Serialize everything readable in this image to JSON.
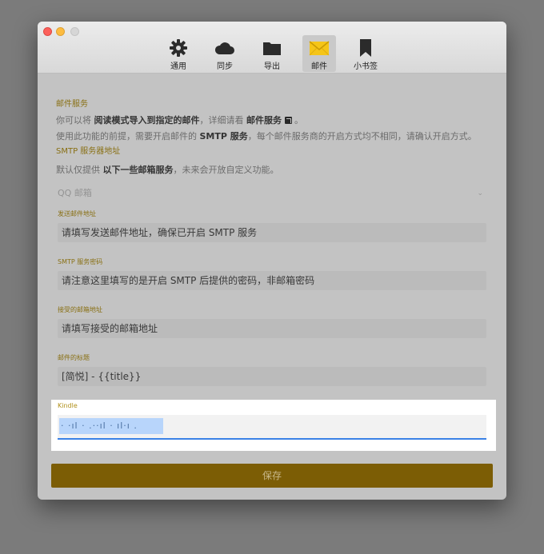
{
  "toolbar": {
    "tabs": [
      {
        "label": "通用",
        "icon": "gear-icon"
      },
      {
        "label": "同步",
        "icon": "cloud-icon"
      },
      {
        "label": "导出",
        "icon": "folder-icon"
      },
      {
        "label": "邮件",
        "icon": "mail-icon",
        "active": true
      },
      {
        "label": "小书签",
        "icon": "bookmark-icon"
      }
    ]
  },
  "mail_service": {
    "heading": "邮件服务",
    "line1_prefix": "你可以将",
    "line1_bold": "阅读模式导入到指定的邮件",
    "line1_mid": "，详细请看",
    "line1_link": "邮件服务",
    "line1_suffix": "。",
    "line2_prefix": "使用此功能的前提，需要开启邮件的",
    "line2_bold": "SMTP 服务",
    "line2_suffix": "，每个邮件服务商的开启方式均不相同，请确认开启方式。"
  },
  "smtp_server": {
    "heading": "SMTP 服务器地址",
    "desc_prefix": "默认仅提供",
    "desc_bold": "以下一些邮箱服务",
    "desc_suffix": "，未来会开放自定义功能。",
    "selected": "QQ 邮箱"
  },
  "fields": {
    "sender_label": "发送邮件地址",
    "sender_placeholder": "请填写发送邮件地址，确保已开启 SMTP 服务",
    "password_label": "SMTP 服务密码",
    "password_placeholder": "请注意这里填写的是开启 SMTP 后提供的密码，非邮箱密码",
    "receiver_label": "接受的邮箱地址",
    "receiver_placeholder": "请填写接受的邮箱地址",
    "subject_label": "邮件的标题",
    "subject_value": "[简悦] - {{title}}",
    "kindle_label": "Kindle",
    "kindle_value": "‧ ·ıl · .‧‧ıl ·  ıl‧ı ."
  },
  "save_label": "保存",
  "colors": {
    "accent_gold": "#b0901a",
    "save_bg": "#7c5d05",
    "focus_blue": "#3b82e6",
    "selection": "#b8d5fb"
  }
}
